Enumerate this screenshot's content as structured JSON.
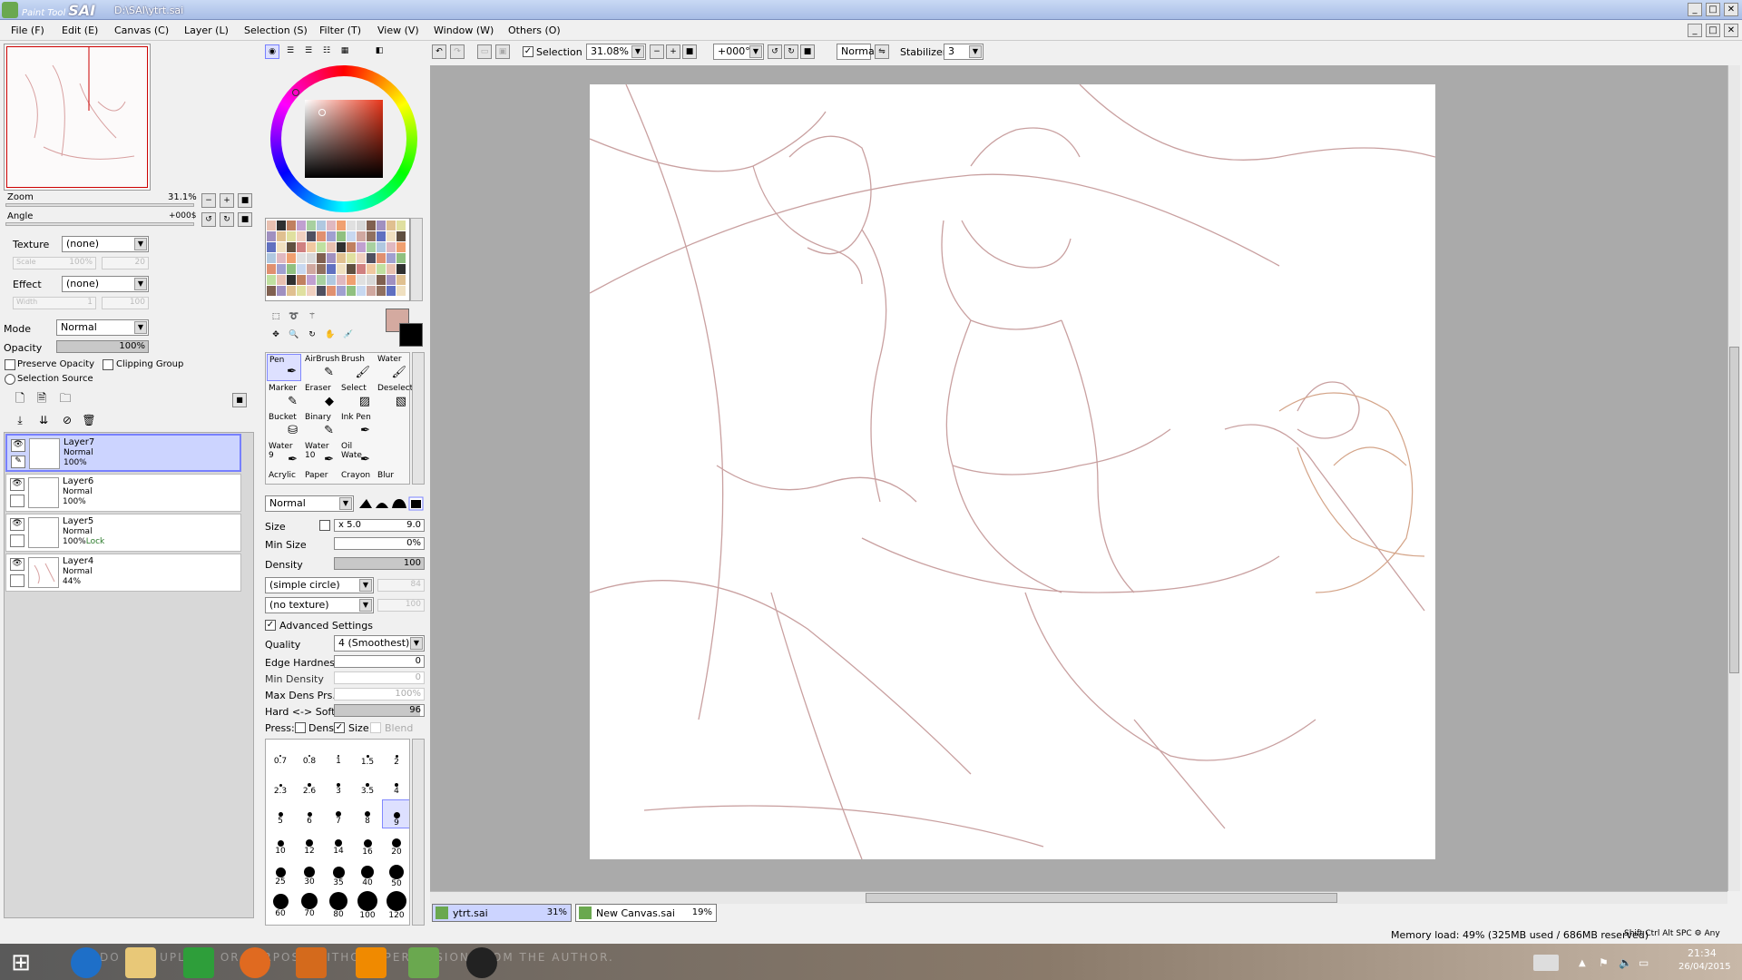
{
  "titlebar": {
    "brand_small": "Paint Tool",
    "brand_big": "SAI",
    "path": "D:\\SAI\\ytrt.sai"
  },
  "menu": [
    "File (F)",
    "Edit (E)",
    "Canvas (C)",
    "Layer (L)",
    "Selection (S)",
    "Filter (T)",
    "View (V)",
    "Window (W)",
    "Others (O)"
  ],
  "navigator": {
    "zoom_label": "Zoom",
    "zoom_value": "31.1%",
    "angle_label": "Angle",
    "angle_value": "+000$"
  },
  "layer_panel": {
    "texture_label": "Texture",
    "texture_value": "(none)",
    "scale_label": "Scale",
    "scale_value": "100%",
    "scale_num": "20",
    "effect_label": "Effect",
    "effect_value": "(none)",
    "width_label": "Width",
    "width_value": "1",
    "width_num": "100",
    "mode_label": "Mode",
    "mode_value": "Normal",
    "opacity_label": "Opacity",
    "opacity_value": "100%",
    "preserve_opacity": "Preserve Opacity",
    "clipping_group": "Clipping Group",
    "selection_source": "Selection Source",
    "layers": [
      {
        "name": "Layer7",
        "mode": "Normal",
        "opacity": "100%",
        "extra": ""
      },
      {
        "name": "Layer6",
        "mode": "Normal",
        "opacity": "100%",
        "extra": ""
      },
      {
        "name": "Layer5",
        "mode": "Normal",
        "opacity": "100%",
        "extra": "Lock"
      },
      {
        "name": "Layer4",
        "mode": "Normal",
        "opacity": "44%",
        "extra": ""
      }
    ]
  },
  "tools": {
    "row1": [
      "Pen",
      "AirBrush",
      "Brush",
      "Water"
    ],
    "row2": [
      "Marker",
      "Eraser",
      "Select",
      "Deselect"
    ],
    "row3": [
      "Bucket",
      "Binary",
      "Ink Pen",
      ""
    ],
    "row4": [
      "Water 9",
      "Water 10",
      "Oil Wate",
      ""
    ],
    "row5": [
      "Acrylic",
      "Paper",
      "Crayon",
      "Blur"
    ]
  },
  "brush": {
    "blend_mode": "Normal",
    "size_label": "Size",
    "size_mult": "x 5.0",
    "size_value": "9.0",
    "min_size_label": "Min Size",
    "min_size_value": "0%",
    "density_label": "Density",
    "density_value": "100",
    "shape": "(simple circle)",
    "shape_num": "84",
    "texture": "(no texture)",
    "texture_num": "100",
    "advanced": "Advanced Settings",
    "quality_label": "Quality",
    "quality_value": "4 (Smoothest)",
    "edge_label": "Edge Hardness",
    "edge_value": "0",
    "min_density_label": "Min Density",
    "min_density_value": "0",
    "max_dens_label": "Max Dens Prs.",
    "max_dens_value": "100%",
    "hard_soft_label": "Hard <-> Soft",
    "hard_soft_value": "96",
    "press_label": "Press:",
    "press_dens": "Dens",
    "press_size": "Size",
    "press_blend": "Blend"
  },
  "brush_sizes": [
    "0.7",
    "0.8",
    "1",
    "1.5",
    "2",
    "2.3",
    "2.6",
    "3",
    "3.5",
    "4",
    "5",
    "6",
    "7",
    "8",
    "9",
    "10",
    "12",
    "14",
    "16",
    "20",
    "25",
    "30",
    "35",
    "40",
    "50",
    "60",
    "70",
    "80",
    "100",
    "120"
  ],
  "toolbar": {
    "selection_label": "Selection",
    "zoom": "31.08%",
    "angle": "+000°",
    "mode": "Normal",
    "stabilizer_label": "Stabilizer",
    "stabilizer_value": "3"
  },
  "tabs": [
    {
      "name": "ytrt.sai",
      "zoom": "31%"
    },
    {
      "name": "New Canvas.sai",
      "zoom": "19%"
    }
  ],
  "status": {
    "memory": "Memory load: 49% (325MB used / 686MB reserved)",
    "keys": "Shift Ctrl Alt SPC ⚙ Any"
  },
  "taskbar": {
    "time": "21:34",
    "date": "26/04/2015",
    "watermark": "DO NOT UPLOAD OR PURPOSE WITHOUT PERMISSION FROM THE AUTHOR."
  },
  "colors": {
    "accent": "#7780ff",
    "fg_color": "#d4aaa0",
    "bg_color": "#000000"
  }
}
